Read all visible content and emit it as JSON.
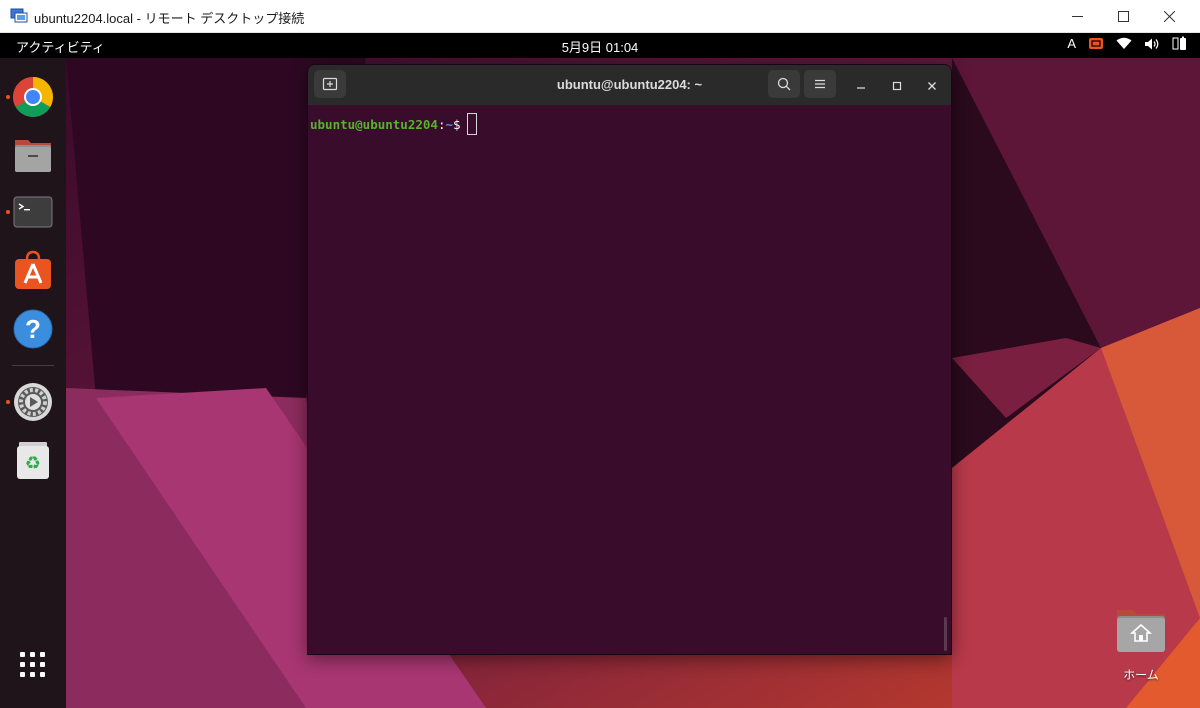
{
  "rdp_window": {
    "title": "ubuntu2204.local - リモート デスクトップ接続",
    "controls": [
      "minimize",
      "maximize",
      "close"
    ]
  },
  "topbar": {
    "activities": "アクティビティ",
    "clock": "5月9日  01:04",
    "input_method": "A",
    "tray_icons": [
      "screen-share-icon",
      "wifi-icon",
      "volume-icon",
      "battery-icon"
    ],
    "accent": "#e95420"
  },
  "dock": {
    "items": [
      {
        "name": "chrome",
        "icon": "chrome-icon",
        "running": true
      },
      {
        "name": "files",
        "icon": "files-icon",
        "running": false
      },
      {
        "name": "terminal",
        "icon": "terminal-icon",
        "running": true
      },
      {
        "name": "app-center",
        "icon": "app-center-icon",
        "running": false
      },
      {
        "name": "help",
        "icon": "help-icon",
        "running": false
      },
      {
        "name": "settings",
        "icon": "settings-icon",
        "running": true
      },
      {
        "name": "trash",
        "icon": "trash-icon",
        "running": false
      }
    ],
    "show_apps_icon": "app-grid-icon"
  },
  "terminal": {
    "title": "ubuntu@ubuntu2204: ~",
    "prompt_user": "ubuntu@ubuntu2204",
    "prompt_colon": ":",
    "prompt_path": "~",
    "prompt_symbol": "$",
    "background": "#380c2a"
  },
  "desktop": {
    "home_label": "ホーム"
  }
}
